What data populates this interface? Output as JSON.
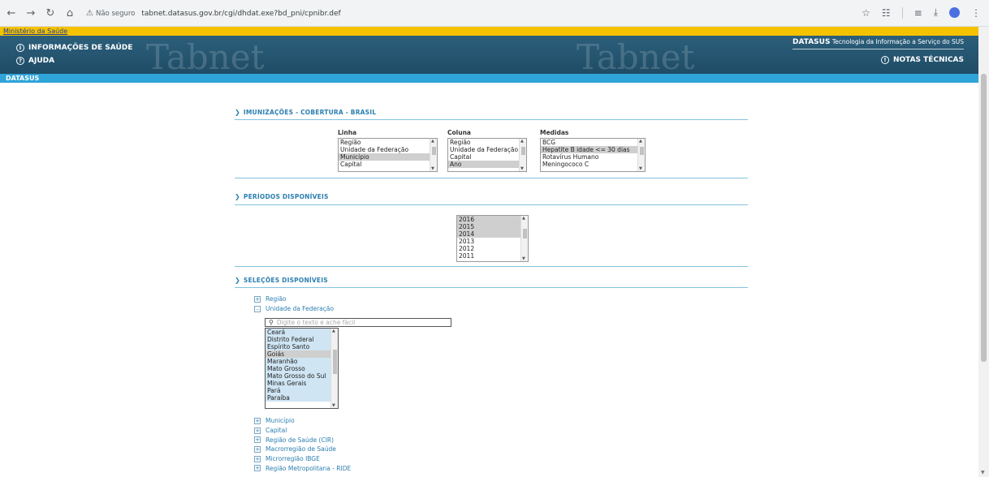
{
  "browser": {
    "not_secure": "Não seguro",
    "url": "tabnet.datasus.gov.br/cgi/dhdat.exe?bd_pni/cpnibr.def"
  },
  "header": {
    "gov_link": "Ministério da Saúde",
    "menu_info": "INFORMAÇÕES DE SAÚDE",
    "menu_help": "AJUDA",
    "watermark": "Tabnet",
    "datasus_brand": "DATASUS",
    "tagline": "Tecnologia da Informação a Serviço do SUS",
    "notas": "NOTAS TÉCNICAS",
    "datasus_bar": "DATASUS"
  },
  "sections": {
    "imunizacoes": "IMUNIZAÇÕES - COBERTURA - BRASIL",
    "periodos": "PERÍODOS DISPONÍVEIS",
    "selecoes": "SELEÇÕES DISPONÍVEIS"
  },
  "linha": {
    "label": "Linha",
    "options": [
      "Região",
      "Unidade da Federação",
      "Município",
      "Capital"
    ],
    "selected": "Município"
  },
  "coluna": {
    "label": "Coluna",
    "options": [
      "Região",
      "Unidade da Federação",
      "Capital",
      "Ano"
    ],
    "selected": "Ano"
  },
  "medidas": {
    "label": "Medidas",
    "options": [
      "BCG",
      "Hepatite B idade <= 30 dias",
      "Rotavírus Humano",
      "Meningococo C"
    ],
    "selected": "Hepatite B idade <= 30 dias"
  },
  "periodos": {
    "options": [
      "2016",
      "2015",
      "2014",
      "2013",
      "2012",
      "2011"
    ],
    "selected": [
      "2016",
      "2015",
      "2014"
    ]
  },
  "selecoes": {
    "regiao": "Região",
    "uf": "Unidade da Federação",
    "uf_search_placeholder": "Digite o texto e ache fácil",
    "uf_options": [
      "Ceará",
      "Distrito Federal",
      "Espírito Santo",
      "Goiás",
      "Maranhão",
      "Mato Grosso",
      "Mato Grosso do Sul",
      "Minas Gerais",
      "Pará",
      "Paraíba"
    ],
    "uf_selected": [
      "Ceará",
      "Distrito Federal",
      "Espírito Santo",
      "Maranhão",
      "Mato Grosso",
      "Mato Grosso do Sul",
      "Minas Gerais",
      "Pará",
      "Paraíba"
    ],
    "uf_highlight": "Goiás",
    "collapsed": [
      "Município",
      "Capital",
      "Região de Saúde (CIR)",
      "Macrorregião de Saúde",
      "Microrregião IBGE",
      "Região Metropolitana - RIDE"
    ]
  }
}
